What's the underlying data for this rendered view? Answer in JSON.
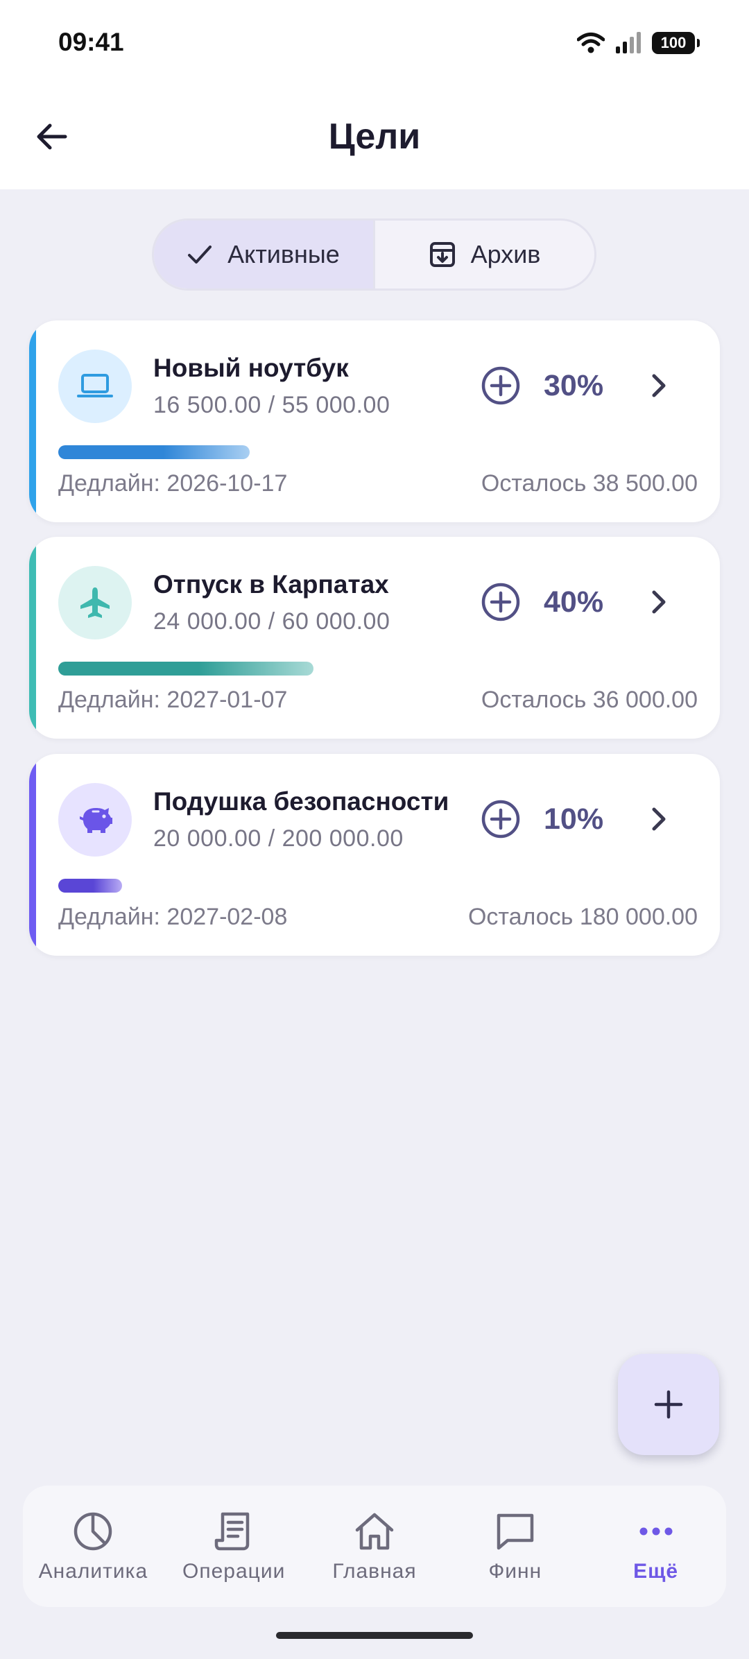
{
  "status_bar": {
    "time": "09:41",
    "battery": "100"
  },
  "header": {
    "title": "Цели",
    "back_icon": "arrow-left-icon"
  },
  "tabs": [
    {
      "label": "Активные",
      "icon": "check-icon",
      "active": true
    },
    {
      "label": "Архив",
      "icon": "archive-icon",
      "active": false
    }
  ],
  "goals": [
    {
      "title": "Новый ноутбук",
      "amounts": "16 500.00 / 55 000.00",
      "percent": "30%",
      "progress": 0.3,
      "deadline": "Дедлайн: 2026-10-17",
      "remaining": "Осталось 38 500.00",
      "icon": "laptop-icon",
      "accent": "#2fa2ea",
      "icon_bg": "#dcefff",
      "bar_from": "#2f86d8",
      "bar_to": "#a9cff2"
    },
    {
      "title": "Отпуск в Карпатах",
      "amounts": "24 000.00 / 60 000.00",
      "percent": "40%",
      "progress": 0.4,
      "deadline": "Дедлайн: 2027-01-07",
      "remaining": "Осталось 36 000.00",
      "icon": "airplane-icon",
      "accent": "#3ebcb4",
      "icon_bg": "#ddf3f1",
      "bar_from": "#2f9e97",
      "bar_to": "#a8dad6"
    },
    {
      "title": "Подушка безопасности",
      "amounts": "20 000.00 / 200 000.00",
      "percent": "10%",
      "progress": 0.1,
      "deadline": "Дедлайн: 2027-02-08",
      "remaining": "Осталось 180 000.00",
      "icon": "piggy-bank-icon",
      "accent": "#6e5cf2",
      "icon_bg": "#e7e3ff",
      "bar_from": "#5a46d6",
      "bar_to": "#b8abf4"
    }
  ],
  "fab": {
    "icon": "plus-icon"
  },
  "bottom_nav": [
    {
      "label": "Аналитика",
      "icon": "pie-chart-icon",
      "active": false
    },
    {
      "label": "Операции",
      "icon": "receipt-icon",
      "active": false
    },
    {
      "label": "Главная",
      "icon": "home-icon",
      "active": false
    },
    {
      "label": "Финн",
      "icon": "chat-icon",
      "active": false
    },
    {
      "label": "Ещё",
      "icon": "more-dots-icon",
      "active": true
    }
  ],
  "colors": {
    "primary": "#6e58e6",
    "text_dark": "#1d1b2e",
    "background": "#efeff6",
    "percent": "#525085"
  }
}
